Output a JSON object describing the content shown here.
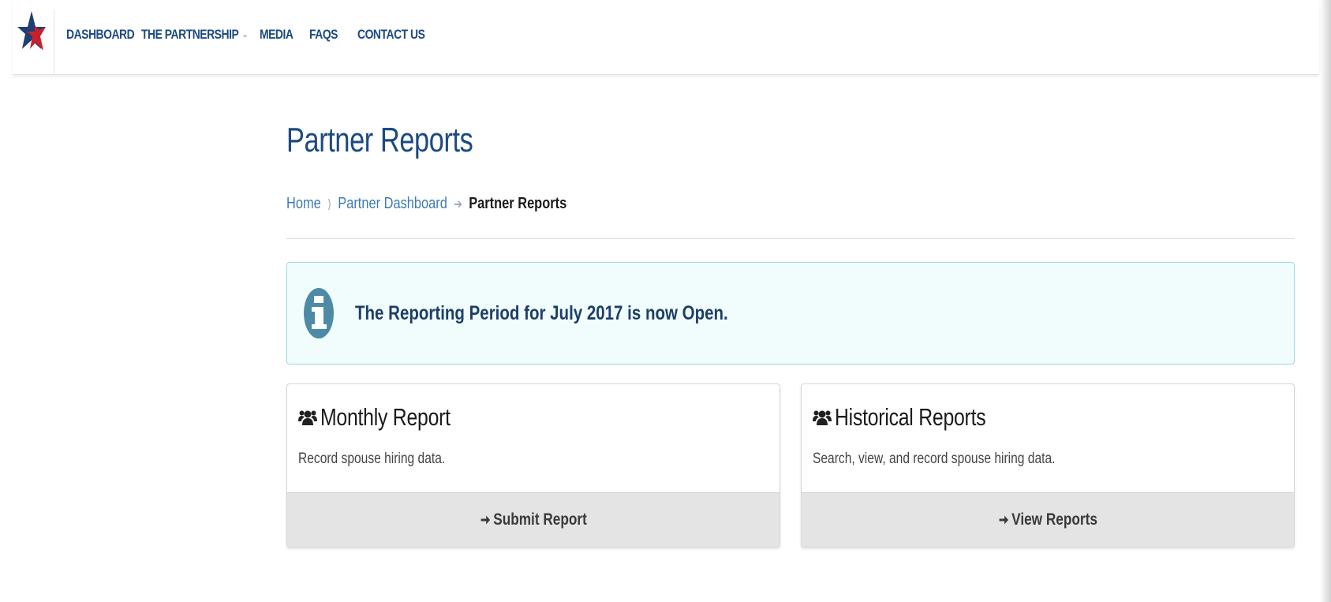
{
  "nav": {
    "logo_alt": "Military Spouse Employment Partnership star logo",
    "items": [
      {
        "label": "DASHBOARD"
      },
      {
        "label": "THE PARTNERSHIP",
        "has_dropdown": true
      },
      {
        "label": "MEDIA"
      },
      {
        "label": "FAQS"
      },
      {
        "label": "CONTACT US"
      }
    ]
  },
  "page": {
    "title": "Partner Reports"
  },
  "breadcrumb": {
    "home": "Home",
    "dashboard": "Partner Dashboard",
    "current": "Partner Reports"
  },
  "alert": {
    "icon": "info-icon",
    "message": "The Reporting Period for July 2017 is now Open."
  },
  "cards": [
    {
      "icon": "users-icon",
      "title": "Monthly Report",
      "description": "Record spouse hiring data.",
      "action_icon": "arrow-right-icon",
      "action_label": "Submit Report"
    },
    {
      "icon": "users-icon",
      "title": "Historical Reports",
      "description": "Search, view, and record spouse hiring data.",
      "action_icon": "arrow-right-icon",
      "action_label": "View Reports"
    }
  ],
  "colors": {
    "brand_blue": "#1d4a80",
    "link_blue": "#3f79b5",
    "star_red": "#c8202f",
    "alert_bg": "#f1fcfd",
    "alert_border": "#9dd8e3",
    "info_icon": "#4d8aa6",
    "footer_gray": "#e4e4e4"
  }
}
